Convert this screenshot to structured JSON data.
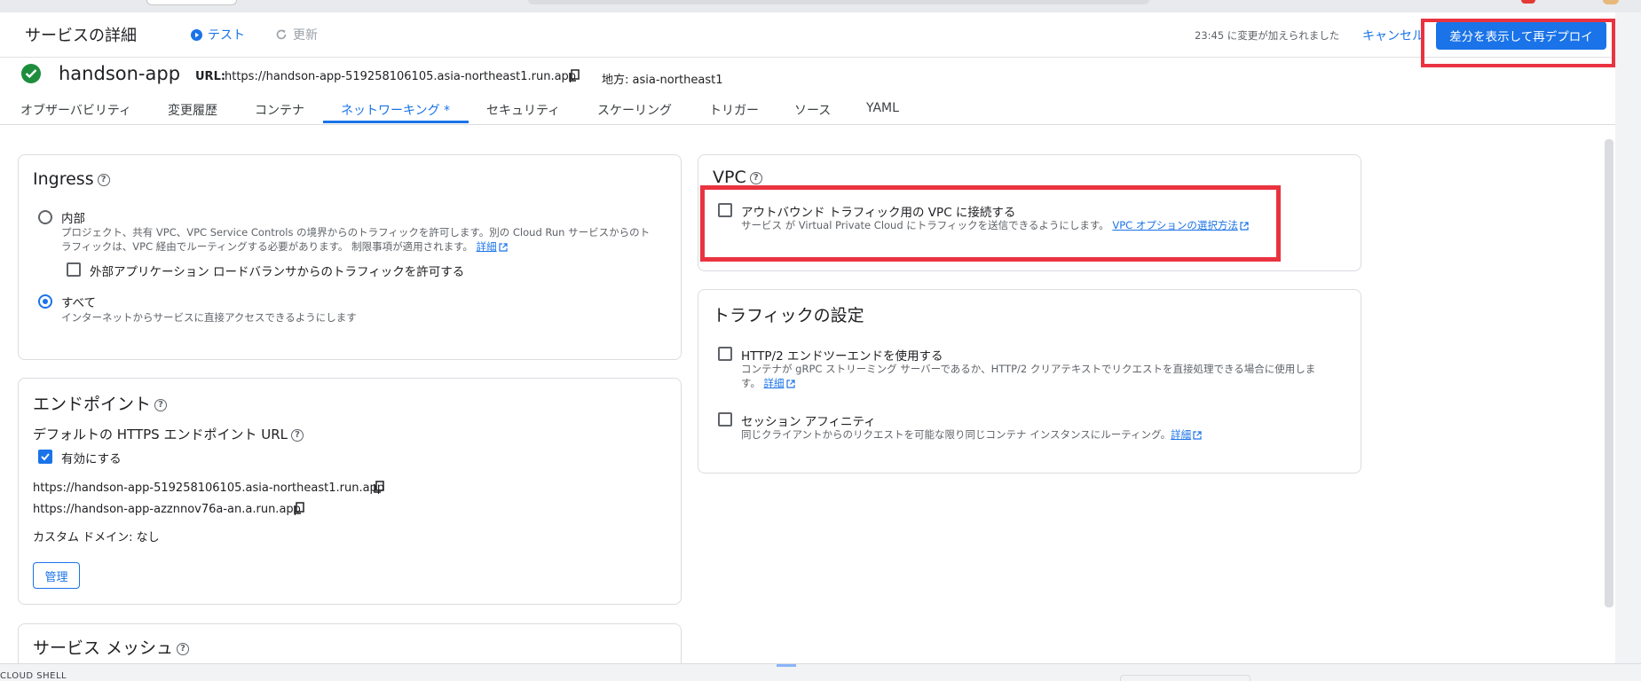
{
  "header": {
    "title": "サービスの詳細",
    "test_label": "テスト",
    "update_label": "更新",
    "changed_text": "23:45 に変更が加えられました",
    "cancel_label": "キャンセル",
    "redeploy_label": "差分を表示して再デプロイ"
  },
  "service": {
    "name": "handson-app",
    "url_label": "URL:",
    "url": "https://handson-app-519258106105.asia-northeast1.run.app",
    "region_label": "地方: asia-northeast1"
  },
  "tabs": [
    {
      "label": "オブザーバビリティ"
    },
    {
      "label": "変更履歴"
    },
    {
      "label": "コンテナ"
    },
    {
      "label": "ネットワーキング *"
    },
    {
      "label": "セキュリティ"
    },
    {
      "label": "スケーリング"
    },
    {
      "label": "トリガー"
    },
    {
      "label": "ソース"
    },
    {
      "label": "YAML"
    }
  ],
  "ingress": {
    "title": "Ingress",
    "internal_label": "内部",
    "internal_desc_1": "プロジェクト、共有 VPC、VPC Service Controls の境界からのトラフィックを許可します。別の Cloud Run サービスからのト",
    "internal_desc_2": "ラフィックは、VPC 経由でルーティングする必要があります。 制限事項が適用されます。",
    "detail_link": "詳細",
    "external_lb_label": "外部アプリケーション ロードバランサからのトラフィックを許可する",
    "all_label": "すべて",
    "all_desc": "インターネットからサービスに直接アクセスできるようにします"
  },
  "endpoints": {
    "title": "エンドポイント",
    "default_title": "デフォルトの HTTPS エンドポイント URL",
    "enable_label": "有効にする",
    "url1": "https://handson-app-519258106105.asia-northeast1.run.app",
    "url2": "https://handson-app-azznnov76a-an.a.run.app",
    "custom_domain": "カスタム ドメイン: なし",
    "manage_label": "管理"
  },
  "mesh": {
    "title": "サービス メッシュ"
  },
  "vpc": {
    "title": "VPC",
    "connect_label": "アウトバウンド トラフィック用の VPC に接続する",
    "connect_desc": "サービス が Virtual Private Cloud にトラフィックを送信できるようにします。",
    "options_link": "VPC オプションの選択方法"
  },
  "traffic": {
    "title": "トラフィックの設定",
    "http2_label": "HTTP/2 エンドツーエンドを使用する",
    "http2_desc_1": "コンテナが gRPC ストリーミング サーバーであるか、HTTP/2 クリアテキストでリクエストを直接処理できる場合に使用しま",
    "http2_desc_2": "す。",
    "detail_link": "詳細",
    "affinity_label": "セッション アフィニティ",
    "affinity_desc": "同じクライアントからのリクエストを可能な限り同じコンテナ インスタンスにルーティング。",
    "affinity_link": "詳細"
  },
  "footer": {
    "cloud_shell": "CLOUD SHELL"
  },
  "colors": {
    "accent": "#1a73e8",
    "success": "#1e8e3e",
    "highlight": "#ea3340"
  }
}
